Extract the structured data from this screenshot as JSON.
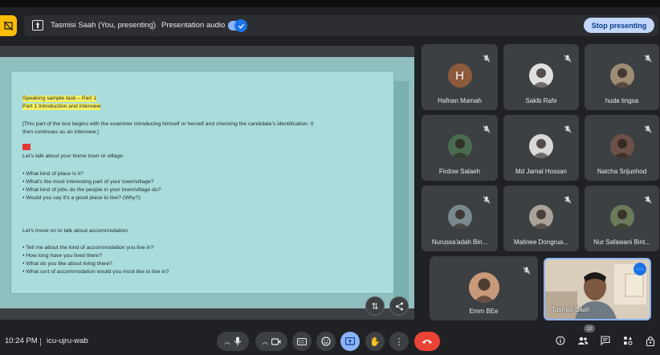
{
  "topbar": {
    "presenter_label": "Tasmisi Saah (You, presenting)",
    "audio_label": "Presentation audio",
    "audio_enabled": true,
    "stop_label": "Stop presenting"
  },
  "slide": {
    "lines": [
      "Speaking sample task – Part 1",
      "Part 1 Introduction and interview",
      "[This part of the test begins with the examiner introducing himself or herself and checking the candidate's identification. It",
      "then continues as an interview.]",
      "Let's talk about your home town or village.",
      "• What kind of place is it?",
      "• What's the most interesting part of your town/village?",
      "• What kind of jobs do the people in your town/village do?",
      "• Would you say it's a good place to live? (Why?)",
      "Let's move on to talk about accommodation.",
      "• Tell me about the kind of accommodation you live in?",
      "• How long have you lived there?",
      "• What do you like about living there?",
      "• What sort of accommodation would you most like to live in?"
    ]
  },
  "participants": [
    {
      "name": "Hafnan Mamah",
      "initial": "H",
      "avatar_color": "#8d5a3b"
    },
    {
      "name": "Sakib Rafe",
      "avatar_color": "#e0e0e0"
    },
    {
      "name": "huda tingsa",
      "avatar_color": "#9e8c74"
    },
    {
      "name": "Firdow Salaeh",
      "avatar_color": "#4a6b4f"
    },
    {
      "name": "Md Jamal Hossan",
      "avatar_color": "#d8d8d8"
    },
    {
      "name": "Natcha Srijunhod",
      "avatar_color": "#6d5148"
    },
    {
      "name": "Nurussa'adah Bin...",
      "avatar_color": "#7a8a8c"
    },
    {
      "name": "Matinee Dongrua...",
      "avatar_color": "#a9a39a"
    },
    {
      "name": "Nur Safawani Bint...",
      "avatar_color": "#6a7a5a"
    },
    {
      "name": "Emm BEe",
      "avatar_color": "#c89a7a"
    }
  ],
  "self_tile": {
    "name": "Tasmisi Saah"
  },
  "bottombar": {
    "time": "10:24 PM",
    "meeting_code": "icu-ujru-wab",
    "people_count": "12"
  },
  "colors": {
    "accent": "#8ab4f8",
    "leave": "#ea4335",
    "highlight": "#f7f061",
    "slide_bg": "#a9dcdb"
  }
}
